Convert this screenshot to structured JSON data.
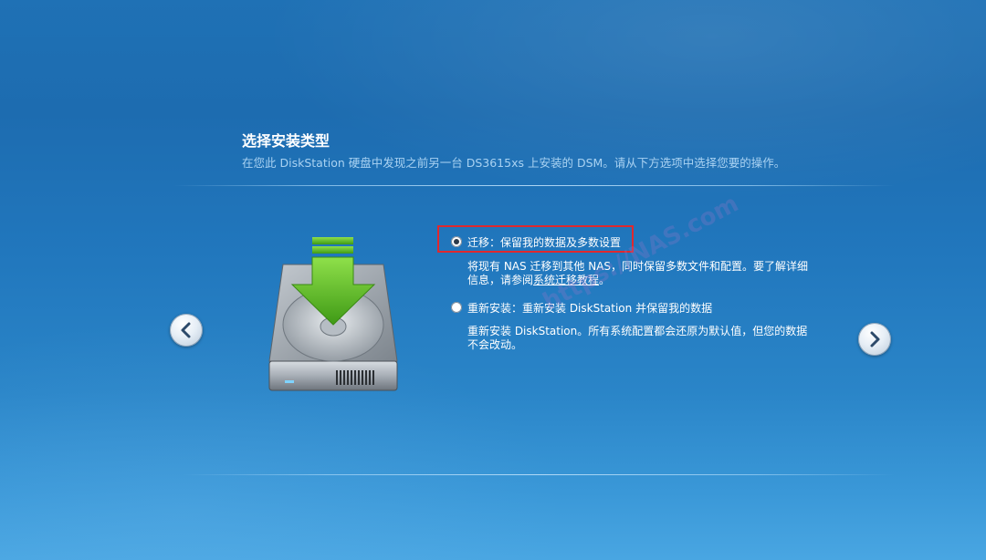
{
  "header": {
    "title": "选择安装类型",
    "subtitle": "在您此 DiskStation 硬盘中发现之前另一台 DS3615xs 上安装的 DSM。请从下方选项中选择您要的操作。"
  },
  "options": [
    {
      "id": "migrate",
      "label": "迁移：保留我的数据及多数设置",
      "selected": true,
      "description_line1": "将现有 NAS 迁移到其他 NAS，同时保留多数文件和配置。要了解详细",
      "description_line2_prefix": "信息，请参阅",
      "link_text": "系统迁移教程",
      "description_line2_suffix": "。"
    },
    {
      "id": "reinstall",
      "label": "重新安装：重新安装 DiskStation 并保留我的数据",
      "selected": false,
      "description_line1": "重新安装 DiskStation。所有系统配置都会还原为默认值，但您的数据",
      "description_line2": "不会改动。"
    }
  ],
  "navigation": {
    "prev_icon": "chevron-left-icon",
    "next_icon": "chevron-right-icon"
  },
  "illustration": {
    "icon": "hard-drive-download-icon"
  },
  "watermark": {
    "text": "https://NAS.com"
  },
  "colors": {
    "highlight_border": "#e0282e",
    "arrow_green": "#5bbf2a",
    "background_blue": "#1f71b5"
  }
}
